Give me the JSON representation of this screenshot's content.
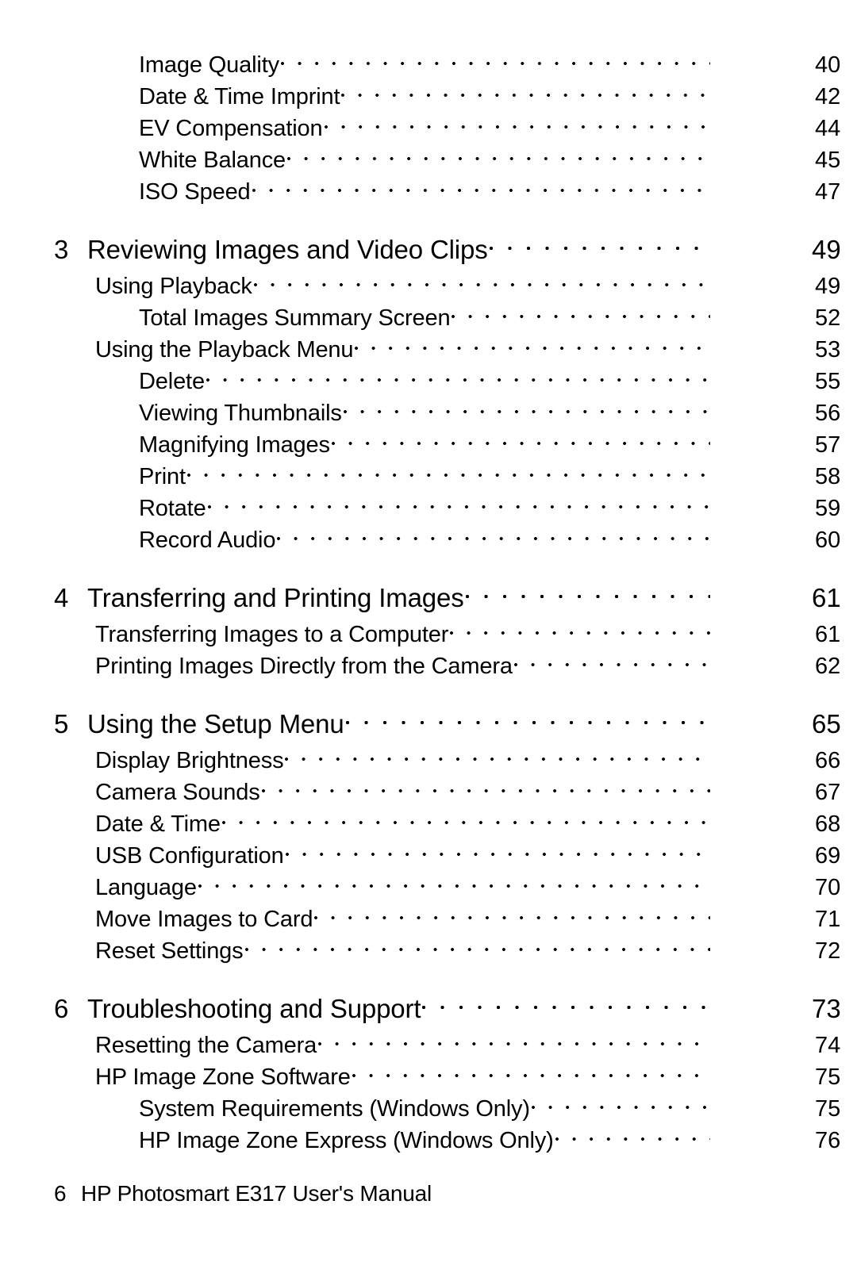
{
  "document": {
    "footer_folio": "6",
    "footer_title": "HP Photosmart E317 User's Manual"
  },
  "toc": {
    "entries": [
      {
        "level": 2,
        "chapter": "",
        "title": "Image Quality",
        "page": "40"
      },
      {
        "level": 2,
        "chapter": "",
        "title": "Date & Time Imprint",
        "page": "42"
      },
      {
        "level": 2,
        "chapter": "",
        "title": "EV Compensation",
        "page": "44"
      },
      {
        "level": 2,
        "chapter": "",
        "title": "White Balance",
        "page": "45"
      },
      {
        "level": 2,
        "chapter": "",
        "title": "ISO Speed",
        "page": "47"
      },
      {
        "level": 0,
        "chapter": "3",
        "title": "Reviewing Images and Video Clips",
        "page": "49"
      },
      {
        "level": 1,
        "chapter": "",
        "title": "Using Playback",
        "page": "49"
      },
      {
        "level": 2,
        "chapter": "",
        "title": "Total Images Summary Screen",
        "page": "52"
      },
      {
        "level": 1,
        "chapter": "",
        "title": "Using the Playback Menu",
        "page": "53"
      },
      {
        "level": 2,
        "chapter": "",
        "title": "Delete",
        "page": "55"
      },
      {
        "level": 2,
        "chapter": "",
        "title": "Viewing Thumbnails",
        "page": "56"
      },
      {
        "level": 2,
        "chapter": "",
        "title": "Magnifying Images",
        "page": "57"
      },
      {
        "level": 2,
        "chapter": "",
        "title": "Print",
        "page": "58"
      },
      {
        "level": 2,
        "chapter": "",
        "title": "Rotate",
        "page": "59"
      },
      {
        "level": 2,
        "chapter": "",
        "title": "Record Audio",
        "page": "60"
      },
      {
        "level": 0,
        "chapter": "4",
        "title": "Transferring and Printing Images",
        "page": "61"
      },
      {
        "level": 1,
        "chapter": "",
        "title": "Transferring Images to a Computer",
        "page": "61"
      },
      {
        "level": 1,
        "chapter": "",
        "title": "Printing Images Directly from the Camera",
        "page": "62"
      },
      {
        "level": 0,
        "chapter": "5",
        "title": "Using the Setup Menu",
        "page": "65"
      },
      {
        "level": 1,
        "chapter": "",
        "title": "Display Brightness",
        "page": "66"
      },
      {
        "level": 1,
        "chapter": "",
        "title": "Camera Sounds",
        "page": "67"
      },
      {
        "level": 1,
        "chapter": "",
        "title": "Date & Time",
        "page": "68"
      },
      {
        "level": 1,
        "chapter": "",
        "title": "USB Configuration",
        "page": "69"
      },
      {
        "level": 1,
        "chapter": "",
        "title": "Language",
        "page": "70"
      },
      {
        "level": 1,
        "chapter": "",
        "title": "Move Images to Card",
        "page": "71"
      },
      {
        "level": 1,
        "chapter": "",
        "title": "Reset Settings",
        "page": "72"
      },
      {
        "level": 0,
        "chapter": "6",
        "title": "Troubleshooting and Support",
        "page": "73"
      },
      {
        "level": 1,
        "chapter": "",
        "title": "Resetting the Camera",
        "page": "74"
      },
      {
        "level": 1,
        "chapter": "",
        "title": "HP Image Zone Software",
        "page": "75"
      },
      {
        "level": 2,
        "chapter": "",
        "title": "System Requirements (Windows Only)",
        "page": "75"
      },
      {
        "level": 2,
        "chapter": "",
        "title": "HP Image Zone Express (Windows Only)",
        "page": "76"
      }
    ]
  }
}
